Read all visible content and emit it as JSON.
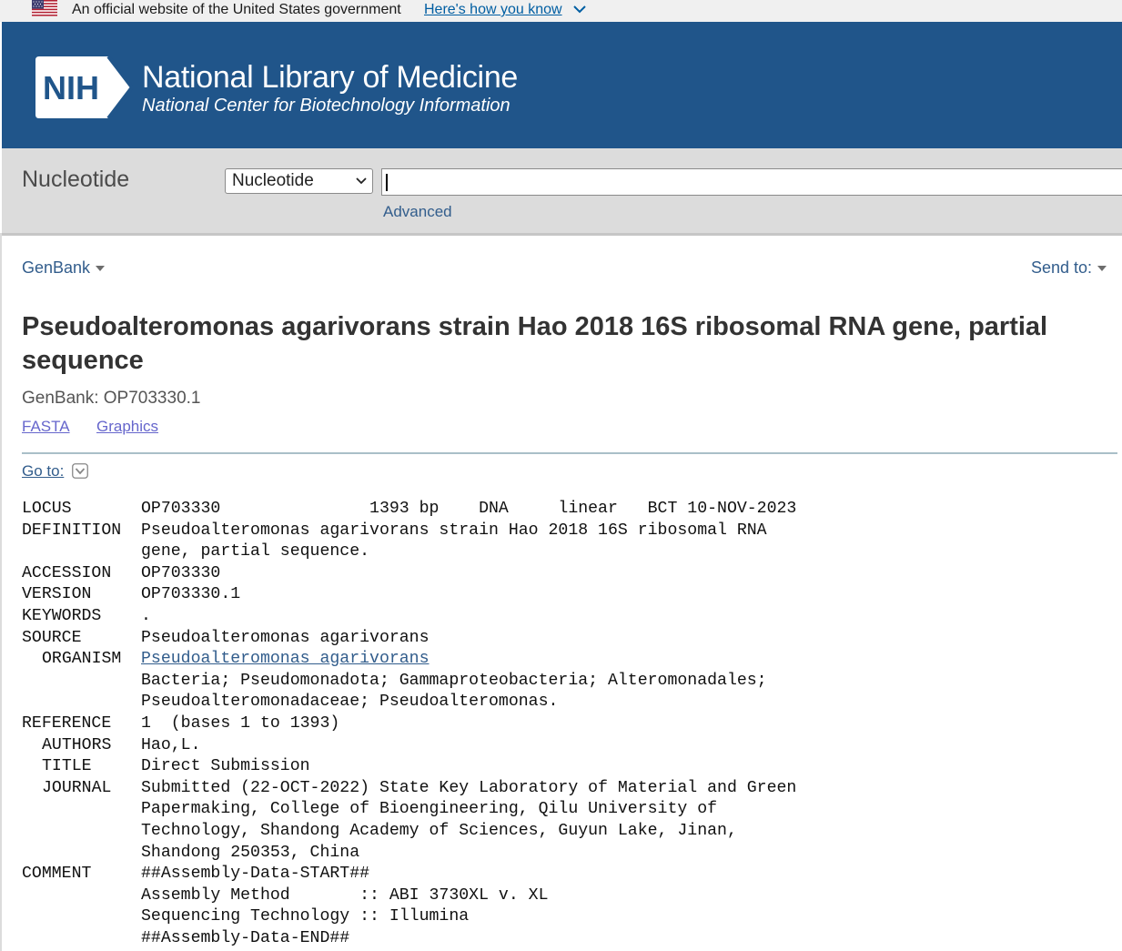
{
  "gov_banner": {
    "text": "An official website of the United States government",
    "link": "Here's how you know"
  },
  "header": {
    "logo_text": "NIH",
    "title": "National Library of Medicine",
    "subtitle": "National Center for Biotechnology Information"
  },
  "search": {
    "db_title": "Nucleotide",
    "db_selected": "Nucleotide",
    "query": "",
    "advanced_label": "Advanced"
  },
  "toolbar": {
    "format_label": "GenBank",
    "send_to_label": "Send to:"
  },
  "record": {
    "title": "Pseudoalteromonas agarivorans strain Hao 2018 16S ribosomal RNA gene, partial sequence",
    "accession_line": "GenBank: OP703330.1",
    "links": {
      "fasta": "FASTA",
      "graphics": "Graphics"
    },
    "goto_label": "Go to:"
  },
  "flat_file": {
    "locus": {
      "key": "LOCUS",
      "value": "OP703330               1393 bp    DNA     linear   BCT 10-NOV-2023"
    },
    "definition": {
      "key": "DEFINITION",
      "lines": [
        "Pseudoalteromonas agarivorans strain Hao 2018 16S ribosomal RNA",
        "gene, partial sequence."
      ]
    },
    "accession": {
      "key": "ACCESSION",
      "value": "OP703330"
    },
    "version": {
      "key": "VERSION",
      "value": "OP703330.1"
    },
    "keywords": {
      "key": "KEYWORDS",
      "value": "."
    },
    "source": {
      "key": "SOURCE",
      "value": "Pseudoalteromonas agarivorans"
    },
    "organism": {
      "key": "ORGANISM",
      "value": "Pseudoalteromonas agarivorans",
      "lineage": [
        "Bacteria; Pseudomonadota; Gammaproteobacteria; Alteromonadales;",
        "Pseudoalteromonadaceae; Pseudoalteromonas."
      ]
    },
    "reference": {
      "key": "REFERENCE",
      "value": "1  (bases 1 to 1393)"
    },
    "authors": {
      "key": "AUTHORS",
      "value": "Hao,L."
    },
    "ref_title": {
      "key": "TITLE",
      "value": "Direct Submission"
    },
    "journal": {
      "key": "JOURNAL",
      "lines": [
        "Submitted (22-OCT-2022) State Key Laboratory of Material and Green",
        "Papermaking, College of Bioengineering, Qilu University of",
        "Technology, Shandong Academy of Sciences, Guyun Lake, Jinan,",
        "Shandong 250353, China"
      ]
    },
    "comment": {
      "key": "COMMENT",
      "lines": [
        "##Assembly-Data-START##",
        "Assembly Method       :: ABI 3730XL v. XL",
        "Sequencing Technology :: Illumina",
        "##Assembly-Data-END##"
      ]
    }
  },
  "colors": {
    "header_bg": "#20558a",
    "search_bar_bg": "#dcdcdc",
    "link": "#325d8c",
    "visited_link": "#66c"
  },
  "icons": [
    "us-flag-icon",
    "chevron-down-icon",
    "nih-logo",
    "dropdown-triangle-icon",
    "goto-chevron-icon"
  ]
}
